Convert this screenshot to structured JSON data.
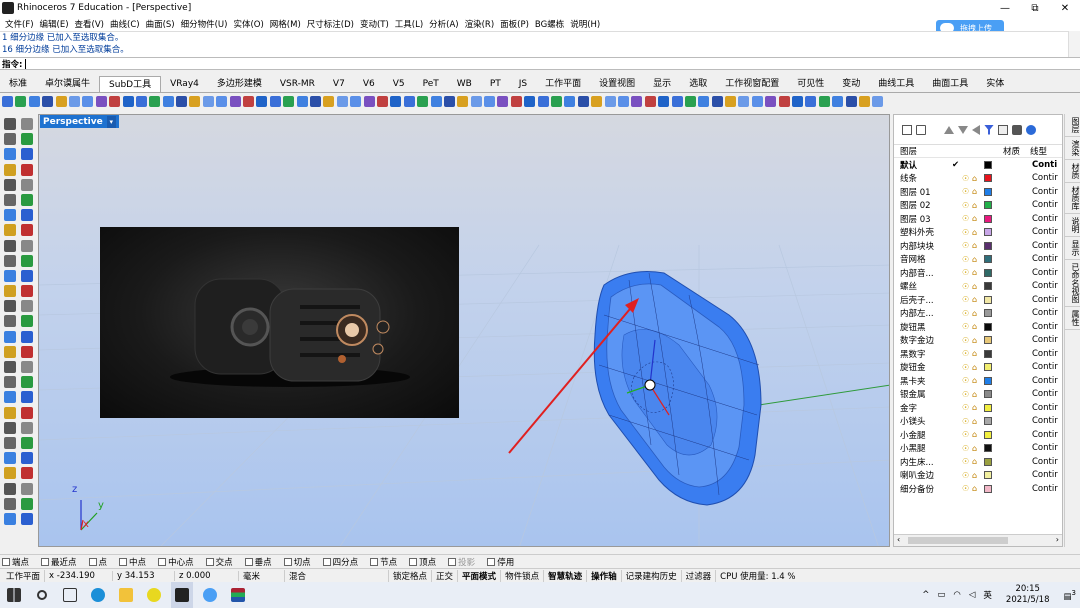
{
  "window": {
    "title": "Rhinoceros 7 Education - [Perspective]",
    "min": "—",
    "max": "⧉",
    "close": "✕"
  },
  "menu": [
    "文件(F)",
    "编辑(E)",
    "查看(V)",
    "曲线(C)",
    "曲面(S)",
    "细分物件(U)",
    "实体(O)",
    "网格(M)",
    "尺寸标注(D)",
    "变动(T)",
    "工具(L)",
    "分析(A)",
    "渲染(R)",
    "面板(P)",
    "BG螺栋",
    "说明(H)"
  ],
  "upload_label": "拖拽上传",
  "history": [
    "1 细分边缘 已加入至选取集合。",
    "16 细分边缘 已加入至选取集合。"
  ],
  "command_prompt": "指令:",
  "tabs": [
    "标准",
    "卓尔谟属牛",
    "SubD工具",
    "VRay4",
    "多边形建模",
    "VSR-MR",
    "V7",
    "V6",
    "V5",
    "PeT",
    "WB",
    "PT",
    "JS",
    "工作平面",
    "设置视图",
    "显示",
    "选取",
    "工作视窗配置",
    "可见性",
    "变动",
    "曲线工具",
    "曲面工具",
    "实体"
  ],
  "active_tab_index": 2,
  "viewport_label": "Perspective",
  "viewport_arrow": "▾",
  "axes": {
    "x": "x",
    "y": "y",
    "z": "z"
  },
  "layer_panel": {
    "headers": {
      "layer": "图层",
      "material": "材质",
      "linetype": "线型"
    },
    "layers": [
      {
        "name": "默认",
        "current": "✔",
        "color": "#000000",
        "linetype": "Conti",
        "bold": true
      },
      {
        "name": "线条",
        "color": "#e8141c",
        "linetype": "Contir"
      },
      {
        "name": "图层 01",
        "color": "#1f7ee8",
        "linetype": "Contir"
      },
      {
        "name": "图层 02",
        "color": "#22b04a",
        "linetype": "Contir"
      },
      {
        "name": "图层 03",
        "color": "#e8187e",
        "linetype": "Contir"
      },
      {
        "name": "塑料外壳",
        "color": "#c8a6e8",
        "linetype": "Contir"
      },
      {
        "name": "内部块块",
        "color": "#5a2f6e",
        "linetype": "Contir"
      },
      {
        "name": "音网格",
        "color": "#2f6e7a",
        "linetype": "Contir"
      },
      {
        "name": "内部音...",
        "color": "#2f6a66",
        "linetype": "Contir"
      },
      {
        "name": "螺丝",
        "color": "#3a3a3a",
        "linetype": "Contir"
      },
      {
        "name": "后壳子...",
        "color": "#f2e8a6",
        "linetype": "Contir"
      },
      {
        "name": "内部左...",
        "color": "#9a9a9a",
        "linetype": "Contir"
      },
      {
        "name": "旋钮黑",
        "color": "#0a0a0a",
        "linetype": "Contir"
      },
      {
        "name": "数字金边",
        "color": "#e8c878",
        "linetype": "Contir"
      },
      {
        "name": "黑数字",
        "color": "#3a3a3a",
        "linetype": "Contir"
      },
      {
        "name": "旋钮金",
        "color": "#f2ee70",
        "linetype": "Contir"
      },
      {
        "name": "黑卡夹",
        "color": "#1f7ee8",
        "linetype": "Contir"
      },
      {
        "name": "银金属",
        "color": "#8a8a8a",
        "linetype": "Contir"
      },
      {
        "name": "金字",
        "color": "#f2ee40",
        "linetype": "Contir"
      },
      {
        "name": "小镁头",
        "color": "#a8a8a8",
        "linetype": "Contir"
      },
      {
        "name": "小金腿",
        "color": "#f2f040",
        "linetype": "Contir"
      },
      {
        "name": "小黑腿",
        "color": "#111111",
        "linetype": "Contir"
      },
      {
        "name": "内生床...",
        "color": "#9aa040",
        "linetype": "Contir"
      },
      {
        "name": "喇叭金边",
        "color": "#f2f0a0",
        "linetype": "Contir"
      },
      {
        "name": "细分备份",
        "color": "#f2b8c8",
        "linetype": "Contir"
      }
    ]
  },
  "side_tabs": [
    "图层",
    "渲染",
    "材质",
    "材质库",
    "说明",
    "显示",
    "已命名视图",
    "属性"
  ],
  "osnaps": [
    {
      "label": "端点"
    },
    {
      "label": "最近点"
    },
    {
      "label": "点"
    },
    {
      "label": "中点"
    },
    {
      "label": "中心点"
    },
    {
      "label": "交点"
    },
    {
      "label": "垂点"
    },
    {
      "label": "切点"
    },
    {
      "label": "四分点"
    },
    {
      "label": "节点"
    },
    {
      "label": "顶点"
    },
    {
      "label": "投影",
      "disabled": true
    },
    {
      "label": "停用"
    }
  ],
  "status": {
    "cplane": "工作平面",
    "x": "x -234.190",
    "y": "y 34.153",
    "z": "z 0.000",
    "unit": "毫米",
    "layer": "混合",
    "items": [
      "锁定格点",
      "正交",
      "平面模式",
      "物件锁点",
      "智慧轨迹",
      "操作轴",
      "记录建构历史",
      "过滤器"
    ],
    "bold_items": [
      2,
      4,
      5
    ],
    "cpu": "CPU 使用量: 1.4 %"
  },
  "taskbar": {
    "time": "20:15",
    "date": "2021/5/18",
    "ime": "英",
    "notify_count": "3"
  }
}
